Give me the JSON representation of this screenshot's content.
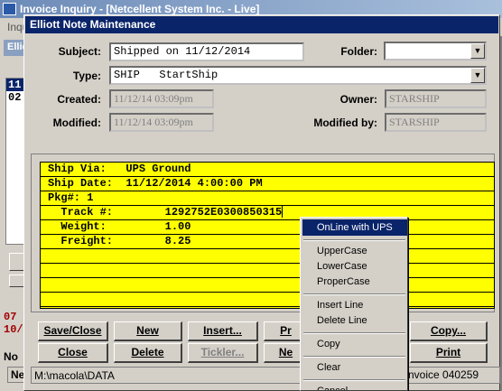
{
  "background_window": {
    "title": "Invoice Inquiry - [Netcellent System Inc. - Live]",
    "menu_text": "Inqu",
    "left_title": "Ellio",
    "list_rows": [
      "11",
      "02"
    ],
    "red_rows": [
      "07",
      "10/"
    ],
    "no_label": "No",
    "ne_button": "Ne"
  },
  "dialog": {
    "title": "Elliott Note Maintenance",
    "subject_label": "Subject:",
    "subject_value": "Shipped on 11/12/2014",
    "folder_label": "Folder:",
    "folder_value": "",
    "type_label": "Type:",
    "type_value": "SHIP   StartShip",
    "created_label": "Created:",
    "created_value": "11/12/14 03:09pm",
    "owner_label": "Owner:",
    "owner_value": "STARSHIP",
    "modified_label": "Modified:",
    "modified_value": "11/12/14 03:09pm",
    "modified_by_label": "Modified by:",
    "modified_by_value": "STARSHIP"
  },
  "note_lines": [
    "Ship Via:   UPS Ground",
    "Ship Date:  11/12/2014 4:00:00 PM",
    "Pkg#: 1",
    "  Track #:        1292752E0300850315",
    "  Weight:         1.00",
    "  Freight:        8.25",
    "",
    "",
    "",
    ""
  ],
  "buttons": {
    "save_close": "Save/Close",
    "new": "New",
    "insert": "Insert...",
    "pr": "Pr",
    "copy": "Copy...",
    "close": "Close",
    "delete": "Delete",
    "tickler": "Tickler...",
    "ne": "Ne",
    "print": "Print"
  },
  "status": {
    "path": "M:\\macola\\DATA",
    "right": "nvoice 040259"
  },
  "context_menu": {
    "items": [
      "OnLine with UPS",
      "UpperCase",
      "LowerCase",
      "ProperCase",
      "Insert Line",
      "Delete Line",
      "Copy",
      "Clear",
      "Cancel"
    ]
  }
}
